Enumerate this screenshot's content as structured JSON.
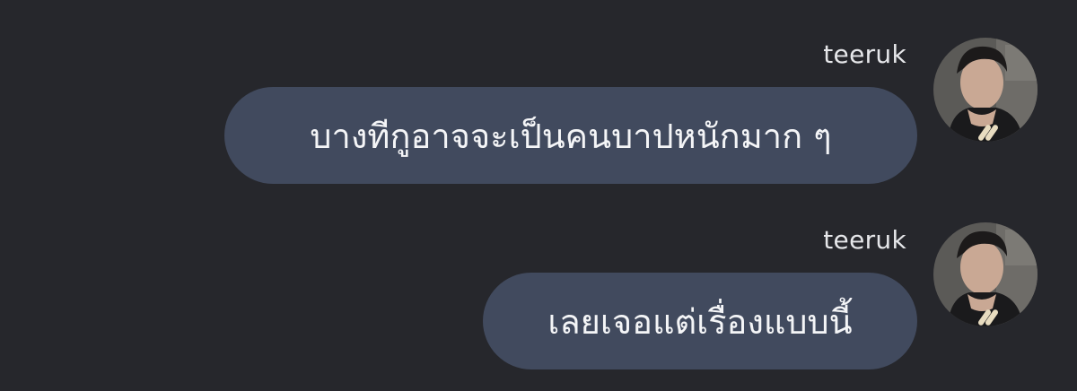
{
  "messages": [
    {
      "sender": "teeruk",
      "text": "บางทีกูอาจจะเป็นคนบาปหนักมาก ๆ",
      "avatar_icon": "user-avatar-photo"
    },
    {
      "sender": "teeruk",
      "text": "เลยเจอแต่เรื่องแบบนี้",
      "avatar_icon": "user-avatar-photo"
    }
  ],
  "colors": {
    "background": "#26272c",
    "bubble": "#414a5e",
    "text": "#f4f5f7"
  }
}
